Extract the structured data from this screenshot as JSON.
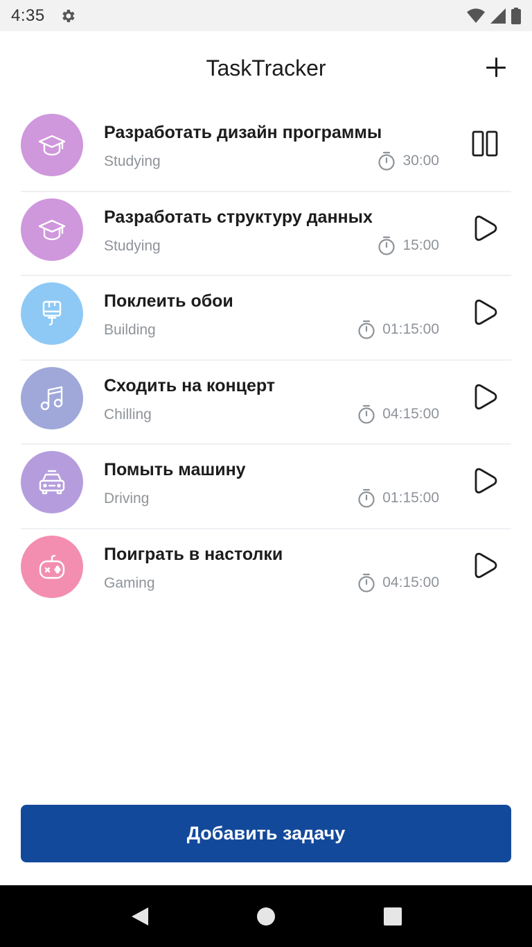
{
  "status_bar": {
    "time": "4:35",
    "icons": [
      "gear-icon",
      "wifi-icon",
      "signal-icon",
      "battery-icon"
    ]
  },
  "header": {
    "title": "TaskTracker",
    "add_icon": "plus-icon"
  },
  "colors": {
    "accent": "#13499a",
    "studying": "#cf97dc",
    "building": "#8ec9f5",
    "chilling": "#9fa8d9",
    "driving": "#b59ddd",
    "gaming": "#f38eb1",
    "muted_text": "#8e9399"
  },
  "tasks": [
    {
      "title": "Разработать дизайн программы",
      "category": "Studying",
      "duration": "30:00",
      "icon": "graduation-cap-icon",
      "color": "#cf97dc",
      "state": "running",
      "action_icon": "pause-icon"
    },
    {
      "title": "Разработать структуру данных",
      "category": "Studying",
      "duration": "15:00",
      "icon": "graduation-cap-icon",
      "color": "#cf97dc",
      "state": "stopped",
      "action_icon": "play-icon"
    },
    {
      "title": "Поклеить обои",
      "category": "Building",
      "duration": "01:15:00",
      "icon": "paint-brush-icon",
      "color": "#8ec9f5",
      "state": "stopped",
      "action_icon": "play-icon"
    },
    {
      "title": "Сходить на концерт",
      "category": "Chilling",
      "duration": "04:15:00",
      "icon": "music-note-icon",
      "color": "#9fa8d9",
      "state": "stopped",
      "action_icon": "play-icon"
    },
    {
      "title": "Помыть машину",
      "category": "Driving",
      "duration": "01:15:00",
      "icon": "car-icon",
      "color": "#b59ddd",
      "state": "stopped",
      "action_icon": "play-icon"
    },
    {
      "title": "Поиграть в настолки",
      "category": "Gaming",
      "duration": "04:15:00",
      "icon": "gamepad-icon",
      "color": "#f38eb1",
      "state": "stopped",
      "action_icon": "play-icon"
    }
  ],
  "add_task_button": {
    "label": "Добавить задачу"
  },
  "nav_bar": {
    "icons": [
      "back-icon",
      "home-icon",
      "recents-icon"
    ]
  }
}
